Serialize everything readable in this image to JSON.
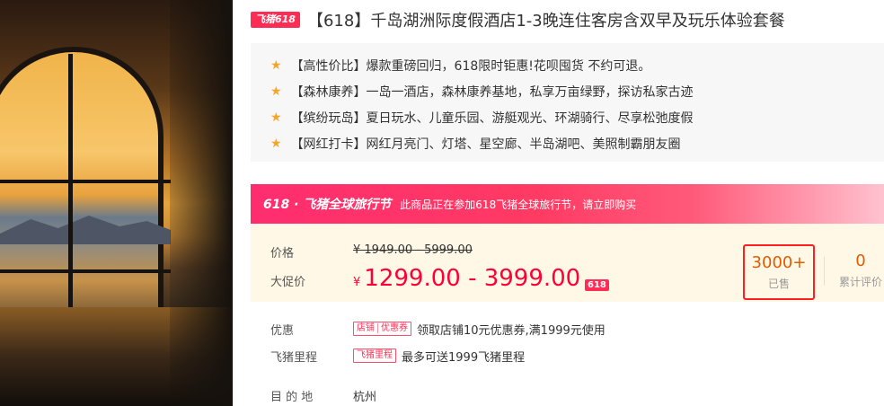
{
  "product": {
    "badge": "飞猪618",
    "title": "【618】千岛湖洲际度假酒店1-3晚连住客房含双早及玩乐体验套餐"
  },
  "highlights": [
    "【高性价比】爆款重磅回归，618限时钜惠!花呗囤货 不约可退。",
    "【森林康养】一岛一酒店，森林康养基地，私享万亩绿野，探访私家古迹",
    "【缤纷玩岛】夏日玩水、儿童乐园、游艇观光、环湖骑行、尽享松弛度假",
    "【网红打卡】网红月亮门、灯塔、星空廊、半岛湖吧、美照制霸朋友圈"
  ],
  "banner": {
    "logo": "618 · 飞猪全球旅行节",
    "text": "此商品正在参加618飞猪全球旅行节，请立即购买"
  },
  "price": {
    "orig_label": "价格",
    "orig_value": "¥ 1949.00 - 5999.00",
    "promo_label": "大促价",
    "currency": "¥",
    "promo_value": "1299.00 - 3999.00",
    "promo_tag": "618"
  },
  "stats": {
    "sold_value": "3000+",
    "sold_label": "已售",
    "review_value": "0",
    "review_label": "累计评价"
  },
  "coupon": {
    "label": "优惠",
    "chip_a": "店铺",
    "chip_b": "优惠券",
    "text": "领取店铺10元优惠券,满1999元使用"
  },
  "mileage": {
    "label": "飞猪里程",
    "chip": "飞猪里程",
    "text": "最多可送1999飞猪里程"
  },
  "destination": {
    "label": "目 的 地",
    "value": "杭州"
  },
  "colors": {
    "accent": "#ff2d55",
    "price": "#ff0036",
    "sold": "#e15b00",
    "star": "#f5a623"
  }
}
